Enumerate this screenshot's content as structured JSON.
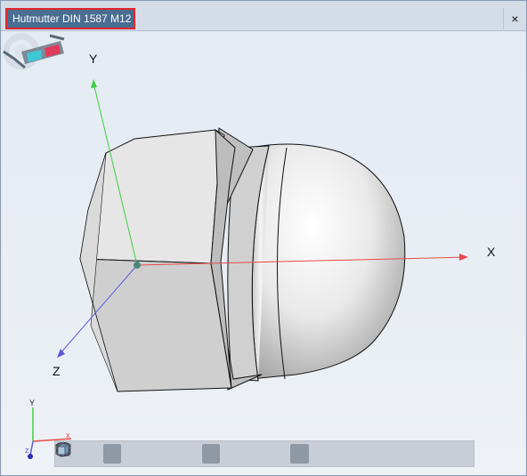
{
  "window": {
    "title": "Hutmutter DIN 1587 M12",
    "close_glyph": "×"
  },
  "viewport": {
    "axis_labels": {
      "x": "X",
      "y": "Y",
      "z": "Z"
    },
    "mini_axis_labels": {
      "y": "Y",
      "x": "x",
      "z": "z"
    },
    "axis_colors": {
      "x": "#e84a4a",
      "y": "#3fcf3f",
      "z": "#5a5adc"
    }
  },
  "toolbar": {
    "buttons": [
      {
        "icon": "view-wireframe-icon",
        "active": false
      },
      {
        "icon": "view-shaded-icon",
        "active": false
      },
      {
        "icon": "view-solid-icon",
        "active": true
      },
      {
        "icon": "zoom-icon",
        "active": false
      },
      {
        "icon": "zoom-window-icon",
        "active": false
      },
      {
        "icon": "rotate-icon",
        "active": false
      },
      {
        "icon": "dimension-icon",
        "active": true
      },
      {
        "icon": "mesh-icon",
        "active": false
      },
      {
        "icon": "section-icon",
        "active": false
      },
      {
        "icon": "color-icon",
        "active": false
      },
      {
        "icon": "transparency-icon",
        "active": true
      },
      {
        "icon": "view-front-icon",
        "active": false
      },
      {
        "icon": "view-back-icon",
        "active": false
      },
      {
        "icon": "view-left-icon",
        "active": false
      },
      {
        "icon": "view-right-icon",
        "active": false
      },
      {
        "icon": "view-top-icon",
        "active": false
      },
      {
        "icon": "view-bottom-icon",
        "active": false
      },
      {
        "icon": "view-iso-icon",
        "active": false
      }
    ]
  }
}
